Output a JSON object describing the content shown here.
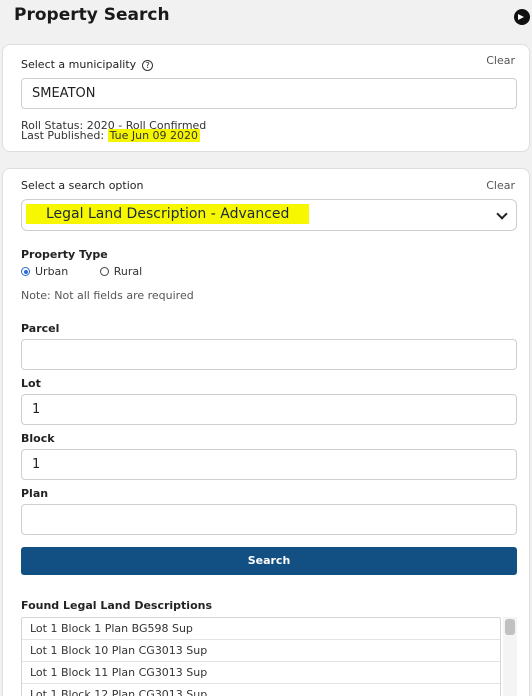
{
  "header": {
    "title": "Property Search"
  },
  "municipality": {
    "label": "Select a municipality",
    "clear_label": "Clear",
    "value": "SMEATON",
    "roll_status": "Roll Status:  2020 - Roll Confirmed",
    "last_published_label": "Last Published:",
    "last_published_value": "Tue Jun 09 2020"
  },
  "search": {
    "label": "Select a search option",
    "clear_label": "Clear",
    "selected_option": "Legal Land Description - Advanced",
    "property_type_label": "Property Type",
    "property_types": [
      "Urban",
      "Rural"
    ],
    "selected_type": "Urban",
    "note": "Note: Not all fields are required",
    "fields": [
      {
        "label": "Parcel",
        "value": ""
      },
      {
        "label": "Lot",
        "value": "1"
      },
      {
        "label": "Block",
        "value": "1"
      },
      {
        "label": "Plan",
        "value": ""
      }
    ],
    "search_button": "Search"
  },
  "results": {
    "label": "Found Legal Land Descriptions",
    "items": [
      "Lot 1 Block 1 Plan BG598 Sup",
      "Lot 1 Block 10 Plan CG3013 Sup",
      "Lot 1 Block 11 Plan CG3013 Sup",
      "Lot 1 Block 12 Plan CG3013 Sup"
    ]
  },
  "colors": {
    "primary_button": "#124f82",
    "highlight": "#f5f500",
    "radio_accent": "#2a6bd6"
  },
  "icons": {
    "exit": "arrow-circle-right-icon",
    "help": "question-circle-icon",
    "dropdown": "chevron-down-icon"
  }
}
